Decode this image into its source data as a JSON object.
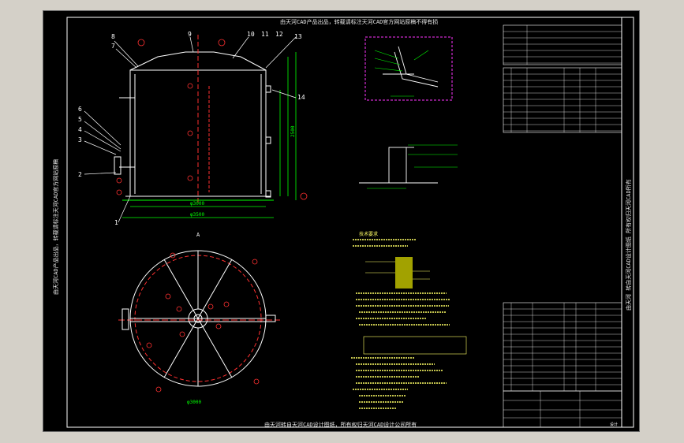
{
  "banner_top": "由天河CAD产品出品，转载请标注天河CAD官方网站原稿不得有损",
  "banner_bottom": "由天河转自天河CAD设计图纸，所有权归天河CAD设计公司所有",
  "banner_left": "由天河CAD产品出品，转载请标注天河CAD官方网站原稿",
  "banner_right": "由天河 转自天河CAD设计图纸 所有权归天河CAD所有",
  "callouts": [
    "1",
    "2",
    "3",
    "4",
    "5",
    "6",
    "7",
    "8",
    "9",
    "10",
    "11",
    "12",
    "13",
    "14"
  ],
  "circled_marks": [
    "⑮",
    "⑯",
    "⑰",
    "⑱",
    "⑲",
    "⑳"
  ],
  "view_label_plan": "A",
  "dimension_text": [
    "φ3000",
    "φ3500",
    "2500"
  ],
  "notes_header": "技术要求",
  "title_block_label": "设计",
  "colors": {
    "background": "#000000",
    "frame": "#ffffff",
    "geometry": "#ffffff",
    "dimensions": "#00ff00",
    "callout_red": "#ff3030",
    "detail_magenta": "#ff33ff",
    "text_yellow": "#ffff66",
    "banner": "#e8e8e8"
  }
}
